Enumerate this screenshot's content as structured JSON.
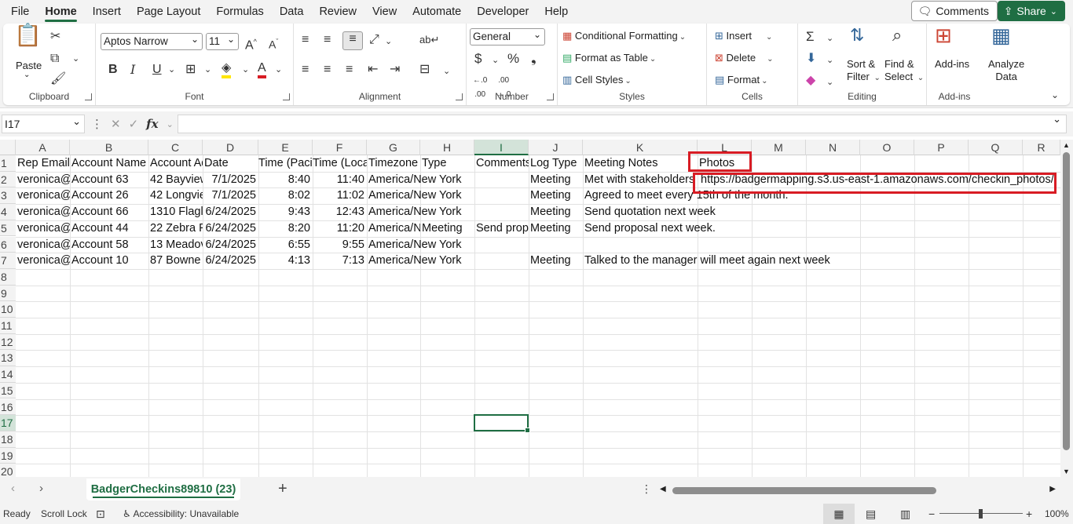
{
  "menu": {
    "items": [
      "File",
      "Home",
      "Insert",
      "Page Layout",
      "Formulas",
      "Data",
      "Review",
      "View",
      "Automate",
      "Developer",
      "Help"
    ],
    "active": "Home",
    "comments_label": "Comments",
    "share_label": "Share"
  },
  "ribbon": {
    "clipboard": {
      "paste": "Paste",
      "label": "Clipboard"
    },
    "font": {
      "name": "Aptos Narrow",
      "size": "11",
      "label": "Font"
    },
    "alignment": {
      "label": "Alignment"
    },
    "number": {
      "format": "General",
      "label": "Number",
      "currency": "$",
      "percent": "%",
      "comma": "❟"
    },
    "styles": {
      "conditional": "Conditional Formatting",
      "table": "Format as Table",
      "cell_styles": "Cell Styles",
      "label": "Styles"
    },
    "cells": {
      "insert": "Insert",
      "delete": "Delete",
      "format": "Format",
      "label": "Cells"
    },
    "editing": {
      "sort1": "Sort &",
      "sort2": "Filter",
      "find1": "Find &",
      "find2": "Select",
      "label": "Editing"
    },
    "addins": {
      "addins": "Add-ins",
      "label": "Add-ins",
      "analyze1": "Analyze",
      "analyze2": "Data"
    }
  },
  "formula_bar": {
    "name_box": "I17",
    "formula": ""
  },
  "columns": [
    "A",
    "B",
    "C",
    "D",
    "E",
    "F",
    "G",
    "H",
    "I",
    "J",
    "K",
    "L",
    "M",
    "N",
    "O",
    "P",
    "Q",
    "R"
  ],
  "selected_column": "I",
  "selected_row": "17",
  "rows": [
    "1",
    "2",
    "3",
    "4",
    "5",
    "6",
    "7",
    "8",
    "9",
    "10",
    "11",
    "12",
    "13",
    "14",
    "15",
    "16",
    "17",
    "18",
    "19",
    "20"
  ],
  "cells": {
    "r1": {
      "A": "Rep Email",
      "B": "Account Name",
      "C": "Account Ad",
      "D": "Date",
      "E": "Time (Paci",
      "F": "Time (Loca",
      "G": "Timezone",
      "H": "Type",
      "I": "Comments",
      "J": "Log Type",
      "K": "Meeting Notes",
      "L": "Photos"
    },
    "r2": {
      "A": "veronica@",
      "B": "Account 63",
      "C": "42 Bayview",
      "D": "7/1/2025",
      "E": "8:40",
      "F": "11:40",
      "G": "America/New York",
      "I": "",
      "J": "Meeting",
      "K": "Met with stakeholders",
      "L": "https://badgermapping.s3.us-east-1.amazonaws.com/checkin_photos/"
    },
    "r3": {
      "A": "veronica@",
      "B": "Account 26",
      "C": "42 Longvie",
      "D": "7/1/2025",
      "E": "8:02",
      "F": "11:02",
      "G": "America/New York",
      "J": "Meeting",
      "K": "Agreed to meet every 15th of the month."
    },
    "r4": {
      "A": "veronica@",
      "B": "Account 66",
      "C": "1310 Flagl",
      "D": "6/24/2025",
      "E": "9:43",
      "F": "12:43",
      "G": "America/New York",
      "J": "Meeting",
      "K": "Send quotation next week"
    },
    "r5": {
      "A": "veronica@",
      "B": "Account 44",
      "C": "22 Zebra P",
      "D": "6/24/2025",
      "E": "8:20",
      "F": "11:20",
      "G": "America/N",
      "H": "Meeting",
      "I": "Send propo",
      "J": "Meeting",
      "K": "Send proposal next week."
    },
    "r6": {
      "A": "veronica@",
      "B": "Account 58",
      "C": "13 Meadov",
      "D": "6/24/2025",
      "E": "6:55",
      "F": "9:55",
      "G": "America/New York"
    },
    "r7": {
      "A": "veronica@",
      "B": "Account 10",
      "C": "87 Bowne S",
      "D": "6/24/2025",
      "E": "4:13",
      "F": "7:13",
      "G": "America/New York",
      "J": "Meeting",
      "K": "Talked to the manager will meet again next week"
    }
  },
  "sheet_tab": "BadgerCheckins89810 (23)",
  "status": {
    "ready": "Ready",
    "scroll_lock": "Scroll Lock",
    "accessibility": "Accessibility: Unavailable",
    "zoom": "100%"
  }
}
